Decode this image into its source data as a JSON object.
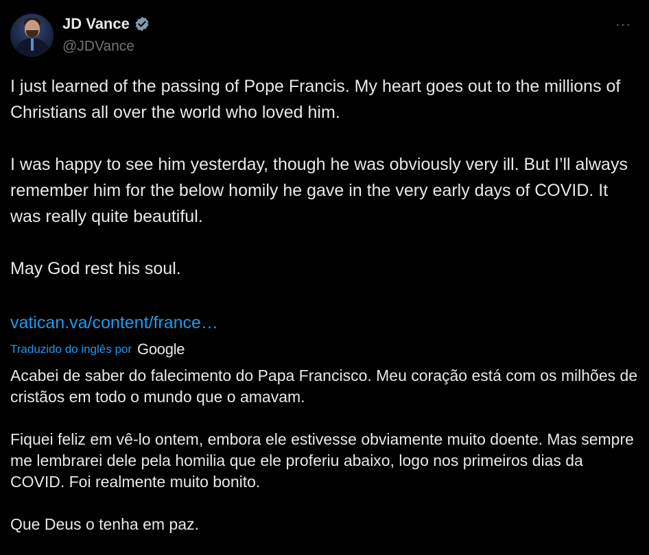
{
  "author": {
    "display_name": "JD Vance",
    "handle": "@JDVance",
    "verified": true,
    "avatar_icon": "profile-photo"
  },
  "more_menu": {
    "label": "···",
    "icon": "more-horizontal-icon"
  },
  "tweet": {
    "paragraphs": [
      "I just learned of the passing of Pope Francis. My heart goes out to the millions of Christians all over the world who loved him.",
      "I was happy to see him yesterday, though he was obviously very ill. But I’ll always remember him for the below homily he gave in the very early days of COVID. It was really quite beautiful.",
      "May God rest his soul."
    ],
    "link": "vatican.va/content/france…"
  },
  "translation": {
    "label": "Traduzido do inglês por",
    "provider": "Google",
    "paragraphs": [
      "Acabei de saber do falecimento do Papa Francisco. Meu coração está com os milhões de cristãos em todo o mundo que o amavam.",
      "Fiquei feliz em vê-lo ontem, embora ele estivesse obviamente muito doente. Mas sempre me lembrarei dele pela homilia que ele proferiu abaixo, logo nos primeiros dias da COVID. Foi realmente muito bonito.",
      "Que Deus o tenha em paz."
    ]
  },
  "colors": {
    "background": "#000000",
    "text": "#e7e9ea",
    "secondary": "#71767b",
    "link": "#1d9bf0",
    "verified_badge": "#829aab"
  }
}
